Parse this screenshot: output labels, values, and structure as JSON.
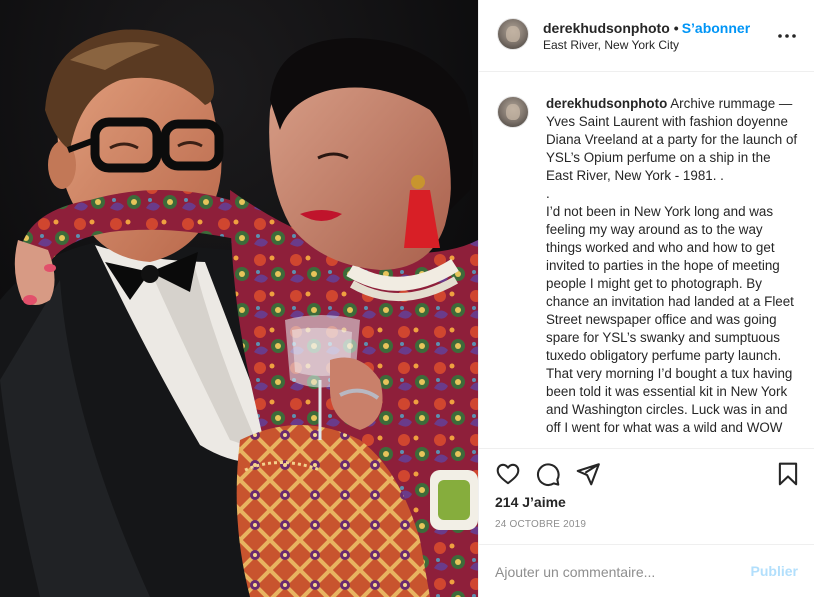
{
  "post": {
    "photo_alt": "Yves Saint Laurent with Diana Vreeland",
    "user": {
      "username": "derekhudsonphoto",
      "separator": "•",
      "follow_label": "S’abonner",
      "location": "East River, New York City"
    },
    "caption": {
      "username": "derekhudsonphoto",
      "paragraph1": "Archive rummage — Yves Saint Laurent with fashion doyenne Diana Vreeland at a party for the launch of YSL’s Opium perfume on a ship in the East River, New York - 1981. .",
      "separator": ".",
      "paragraph2": "I’d not been in New York long and was feeling my way around as to the way things worked and who and how to get invited to parties in the hope of meeting people I might get to photograph. By chance an invitation had landed at a Fleet Street newspaper office and was going spare for YSL’s swanky and sumptuous tuxedo obligatory perfume party launch. That very morning I’d bought a tux having been told it was essential kit in New York and Washington circles. Luck was in and off I went for what was a wild and WOW"
    },
    "actions": {
      "icons": [
        "heart-icon",
        "comment-icon",
        "share-icon",
        "bookmark-icon"
      ],
      "likes": "214 J’aime",
      "date": "24 OCTOBRE 2019"
    },
    "comment": {
      "placeholder": "Ajouter un commentaire...",
      "value": "",
      "publish_label": "Publier"
    }
  }
}
